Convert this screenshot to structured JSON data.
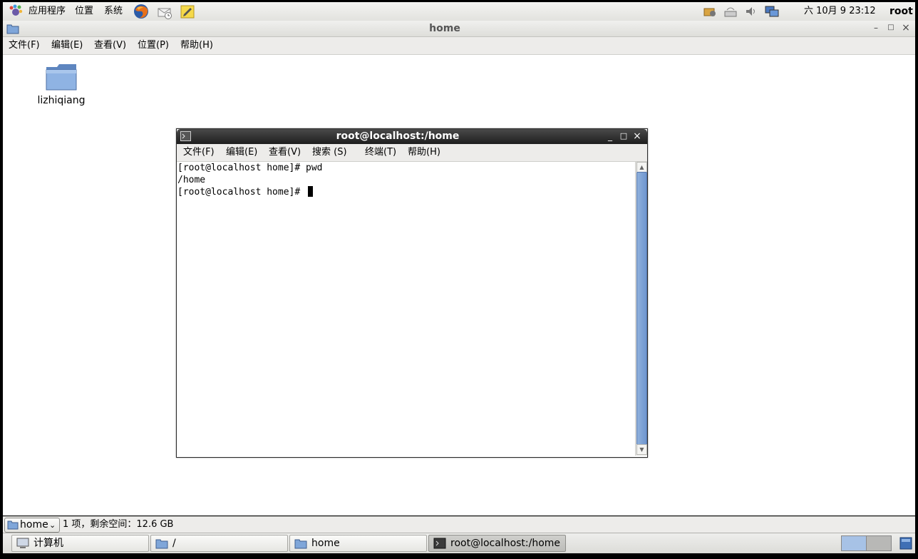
{
  "top_panel": {
    "menus": [
      "应用程序",
      "位置",
      "系统"
    ],
    "launchers": [
      "firefox-icon",
      "mail-icon",
      "notes-icon"
    ],
    "tray": [
      "update-icon",
      "network-icon",
      "volume-icon",
      "display-icon"
    ],
    "clock": "六 10月  9 23:12",
    "user": "root"
  },
  "nautilus": {
    "title": "home",
    "menu": [
      "文件(F)",
      "编辑(E)",
      "查看(V)",
      "位置(P)",
      "帮助(H)"
    ],
    "folder_label": "lizhiqiang",
    "location": "home",
    "status": "1 项，剩余空间：12.6 GB"
  },
  "terminal": {
    "title": "root@localhost:/home",
    "menu": [
      "文件(F)",
      "编辑(E)",
      "查看(V)",
      "搜索 (S)",
      "终端(T)",
      "帮助(H)"
    ],
    "lines": [
      "[root@localhost home]# pwd",
      "/home",
      "[root@localhost home]# "
    ]
  },
  "taskbar": {
    "tasks": [
      "计算机",
      "/",
      "home",
      "root@localhost:/home"
    ]
  },
  "colors": {
    "terminal_titlebar": "#1e1e1e",
    "scroll_thumb": "#6f96cf",
    "folder": "#7fa6d9"
  }
}
